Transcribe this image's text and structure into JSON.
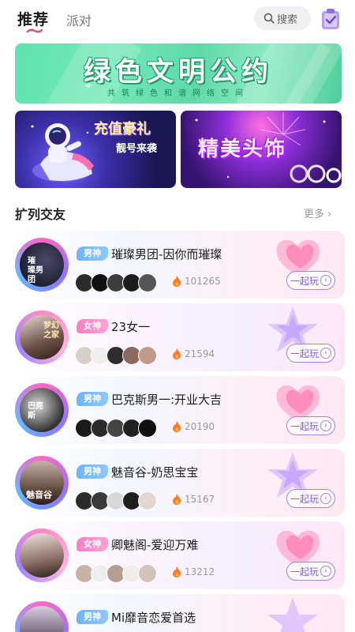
{
  "header": {
    "tabs": [
      {
        "label": "推荐",
        "active": true
      },
      {
        "label": "派对",
        "active": false
      }
    ],
    "search_label": "搜索"
  },
  "banners": {
    "civilization": {
      "title": "绿色文明公约",
      "subtitle": "共筑绿色和谐网络空间"
    },
    "recharge": {
      "title": "充值豪礼",
      "subtitle": "靓号来袭"
    },
    "headwear": {
      "title": "精美头饰"
    }
  },
  "section": {
    "title": "扩列交友",
    "more_label": "更多"
  },
  "rooms": [
    {
      "tag": "男神",
      "gender": "male",
      "name": "璀璨男团-因你而璀璨",
      "heat": "101265",
      "join_label": "一起玩",
      "avatar_text": "璀\n璨男\n团"
    },
    {
      "tag": "女神",
      "gender": "female",
      "name": "23女一",
      "heat": "21594",
      "join_label": "一起玩",
      "avatar_text": "梦幻\n之家"
    },
    {
      "tag": "男神",
      "gender": "male",
      "name": "巴克斯男一:开业大吉",
      "heat": "20190",
      "join_label": "一起玩",
      "avatar_text": "巴克\n斯"
    },
    {
      "tag": "男神",
      "gender": "male",
      "name": "魅音谷-奶思宝宝",
      "heat": "15167",
      "join_label": "一起玩",
      "avatar_text": "魅音谷"
    },
    {
      "tag": "女神",
      "gender": "female",
      "name": "卿魅阁-爱迎万难",
      "heat": "13212",
      "join_label": "一起玩",
      "avatar_text": ""
    },
    {
      "tag": "男神",
      "gender": "male",
      "name": "Mi靡音恋爱首选",
      "heat": "",
      "join_label": "一起玩",
      "avatar_text": ""
    }
  ],
  "colors": {
    "accent_purple": "#7a64d8",
    "male_badge": "#6fb2ff",
    "female_badge": "#ff7fc4",
    "heat_flame": "#ff7a2a",
    "banner_green": "#5fe3b0"
  },
  "icons": {
    "search": "search-icon",
    "task": "task-clipboard-icon",
    "heat": "flame-icon",
    "more": "chevron-right-icon"
  }
}
